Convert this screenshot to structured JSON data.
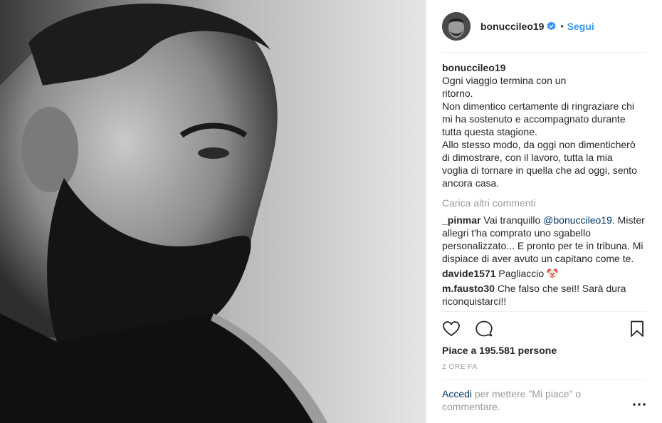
{
  "header": {
    "username": "bonuccileo19",
    "separator": "•",
    "follow_label": "Segui"
  },
  "caption": {
    "username": "bonuccileo19",
    "lines": [
      "Ogni viaggio termina con un",
      "ritorno.",
      "Non dimentico certamente di ringraziare chi",
      "mi ha sostenuto e accompagnato durante",
      "tutta questa stagione.",
      "Allo stesso modo, da oggi non dimenticherò",
      "di dimostrare, con il lavoro, tutta la mia",
      "voglia di tornare in quella che ad oggi, sento",
      "ancora casa."
    ]
  },
  "load_more_label": "Carica altri commenti",
  "comments": [
    {
      "username": "_pinmar",
      "text_before": "Vai tranquillo",
      "mention": "@bonuccileo19",
      "text_after": ". Mister allegri t'ha comprato uno sgabello personalizzato... E pronto per te in tribuna. Mi dispiace di aver avuto un capitano come te."
    },
    {
      "username": "davide1571",
      "text": "Pagliaccio"
    },
    {
      "username": "m.fausto30",
      "text": "Che falso che sei!! Sarà dura riconquistarci!!"
    }
  ],
  "likes_label": "Piace a 195.581 persone",
  "time_label": "2 ORE FA",
  "login": {
    "link_label": "Accedi",
    "rest": "per mettere \"Mi piace\" o commentare."
  },
  "icons": {
    "verified": "verified-badge-icon",
    "like": "heart-icon",
    "comment": "comment-bubble-icon",
    "save": "bookmark-icon",
    "options": "more-options-icon",
    "emoji": "clown-face-emoji"
  },
  "colors": {
    "link": "#3897f0",
    "mention": "#003569",
    "muted": "#999999",
    "text": "#262626"
  }
}
